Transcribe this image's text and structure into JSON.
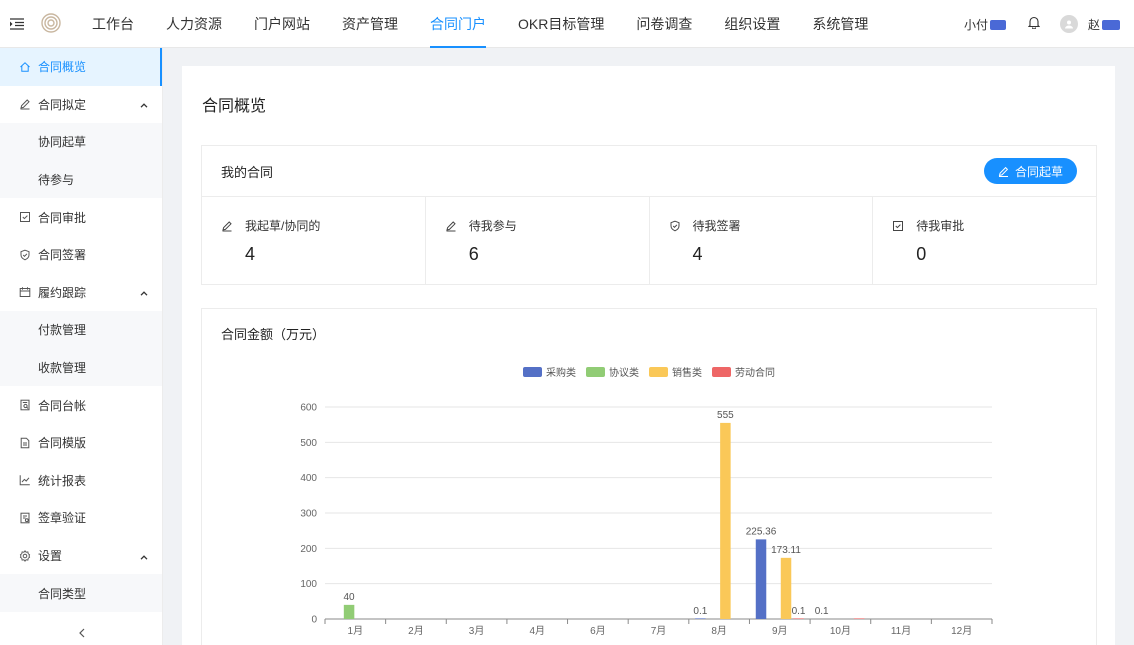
{
  "nav": {
    "items": [
      "工作台",
      "人力资源",
      "门户网站",
      "资产管理",
      "合同门户",
      "OKR目标管理",
      "问卷调查",
      "组织设置",
      "系统管理"
    ],
    "active_index": 4
  },
  "top_right": {
    "org_name": "小付",
    "user_name": "赵"
  },
  "sidebar": {
    "items": [
      {
        "label": "合同概览",
        "icon": "home-icon",
        "active": true
      },
      {
        "label": "合同拟定",
        "icon": "edit-icon",
        "expanded": true,
        "children": [
          "协同起草",
          "待参与"
        ]
      },
      {
        "label": "合同审批",
        "icon": "checkbox-icon"
      },
      {
        "label": "合同签署",
        "icon": "shield-icon"
      },
      {
        "label": "履约跟踪",
        "icon": "calendar-icon",
        "expanded": true,
        "children": [
          "付款管理",
          "收款管理"
        ]
      },
      {
        "label": "合同台帐",
        "icon": "ledger-icon"
      },
      {
        "label": "合同模版",
        "icon": "document-icon"
      },
      {
        "label": "统计报表",
        "icon": "line-chart-icon"
      },
      {
        "label": "签章验证",
        "icon": "stamp-verify-icon"
      },
      {
        "label": "设置",
        "icon": "gear-icon",
        "expanded": true,
        "children": [
          "合同类型"
        ]
      }
    ],
    "collapse_icon": "chevron-left-icon"
  },
  "page": {
    "title": "合同概览"
  },
  "my_contracts": {
    "title": "我的合同",
    "draft_button": "合同起草",
    "stats": [
      {
        "label": "我起草/协同的",
        "value": "4",
        "icon": "edit-icon"
      },
      {
        "label": "待我参与",
        "value": "6",
        "icon": "edit-icon"
      },
      {
        "label": "待我签署",
        "value": "4",
        "icon": "shield-icon"
      },
      {
        "label": "待我审批",
        "value": "0",
        "icon": "checkbox-icon"
      }
    ]
  },
  "amount_section": {
    "title": "合同金额（万元）"
  },
  "colors": {
    "accent": "#1890ff",
    "purchase": "#5470c6",
    "agreement": "#91cc75",
    "sales": "#fac858",
    "labor": "#ee6666"
  },
  "chart_data": {
    "type": "bar",
    "categories": [
      "1月",
      "2月",
      "3月",
      "4月",
      "6月",
      "7月",
      "8月",
      "9月",
      "10月",
      "11月",
      "12月"
    ],
    "series": [
      {
        "name": "采购类",
        "color": "#5470c6",
        "values": [
          0,
          0,
          0,
          0,
          0,
          0,
          0.1,
          225.36,
          0,
          0,
          0
        ]
      },
      {
        "name": "协议类",
        "color": "#91cc75",
        "values": [
          40,
          0,
          0,
          0,
          0,
          0,
          0,
          0,
          0,
          0,
          0
        ]
      },
      {
        "name": "销售类",
        "color": "#fac858",
        "values": [
          0,
          0,
          0,
          0,
          0,
          0,
          555,
          173.11,
          0,
          0,
          0
        ]
      },
      {
        "name": "劳动合同",
        "color": "#ee6666",
        "values": [
          0,
          0,
          0,
          0,
          0,
          0,
          0,
          0.1,
          0.1,
          0,
          0
        ]
      }
    ],
    "labels": [
      {
        "category": "1月",
        "series": "协议类",
        "text": "40"
      },
      {
        "category": "8月",
        "series": "采购类",
        "text": "0.1"
      },
      {
        "category": "8月",
        "series": "销售类",
        "text": "555"
      },
      {
        "category": "9月",
        "series": "采购类",
        "text": "225.36"
      },
      {
        "category": "9月",
        "series": "销售类",
        "text": "173.11"
      },
      {
        "category": "9月",
        "series": "劳动合同",
        "text": "0.1"
      },
      {
        "category": "10月",
        "series": "采购类",
        "text": "0.1"
      }
    ],
    "yticks": [
      "0",
      "100",
      "200",
      "300",
      "400",
      "500",
      "600"
    ],
    "ylim": [
      0,
      600
    ],
    "grid": true,
    "legend_position": "top-center"
  }
}
